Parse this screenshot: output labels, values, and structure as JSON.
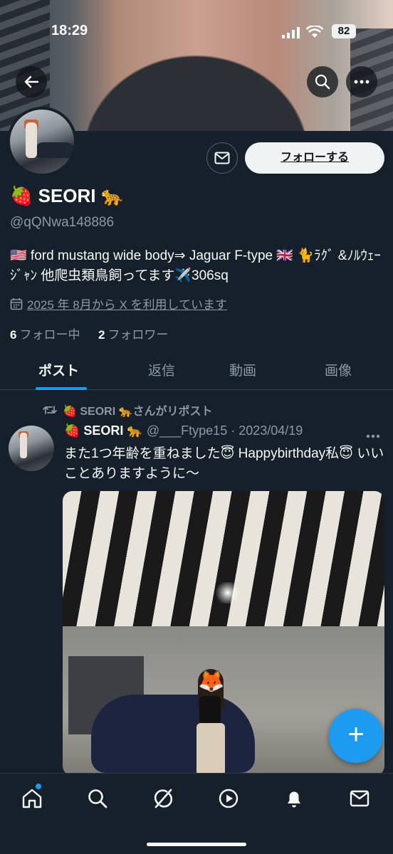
{
  "status": {
    "time": "18:29",
    "battery": "82"
  },
  "profile": {
    "name": "🍓 SEORI 🐆",
    "handle": "@qQNwa148886",
    "bio": "🇺🇸 ford mustang wide body⇒ Jaguar F-type 🇬🇧 🐈ﾗｸﾞ &ﾉﾙｳｪｰｼﾞｬﾝ 他爬虫類鳥飼ってます✈️306sq",
    "joined": "2025 年 8月から X を利用しています",
    "following_count": "6",
    "following_label": "フォロー中",
    "followers_count": "2",
    "followers_label": "フォロワー",
    "follow_button": "フォローする"
  },
  "tabs": [
    {
      "label": "ポスト"
    },
    {
      "label": "返信"
    },
    {
      "label": "動画"
    },
    {
      "label": "画像"
    }
  ],
  "post": {
    "repost_label": "🍓 SEORI 🐆さんがリポスト",
    "author_name": "🍓 SEORI 🐆",
    "author_meta": "@___Ftype15 · 2023/04/19",
    "text": "また1つ年齢を重ねました😇 Happybirthday私😇 いいことありますように〜",
    "image_face": "🦊"
  },
  "fab": {
    "label": "+"
  },
  "colors": {
    "accent": "#1d9bf0",
    "background": "#15202b",
    "muted": "#8b98a5"
  },
  "icons": {
    "back": "back-arrow-icon",
    "search": "search-icon",
    "more": "more-icon",
    "mail": "mail-icon",
    "calendar": "calendar-icon",
    "repost": "repost-icon",
    "nav": [
      "home-icon",
      "search-icon",
      "grok-icon",
      "play-icon",
      "bell-icon",
      "mail-icon"
    ]
  }
}
